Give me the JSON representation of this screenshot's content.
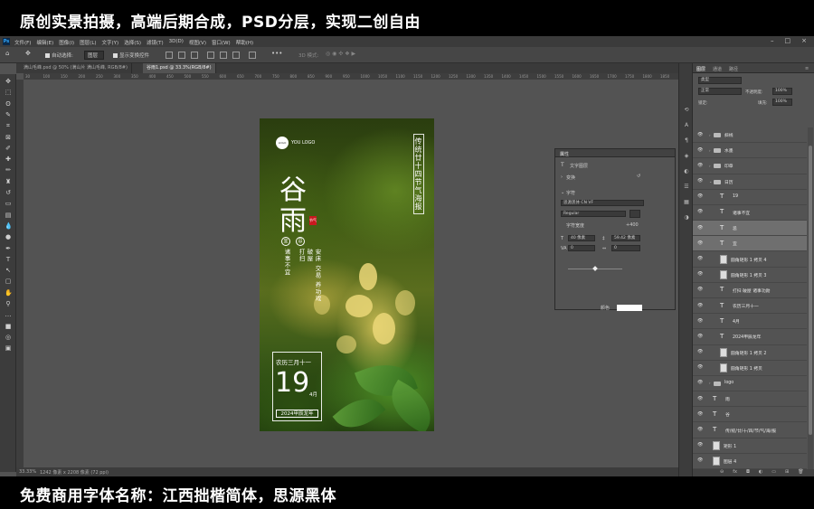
{
  "banner_top": "原创实景拍摄，高端后期合成，PSD分层，实现二创自由",
  "banner_bottom": "免费商用字体名称：江西拙楷简体，思源黑体",
  "menu": {
    "app_badge": "Ps",
    "items": [
      "文件(F)",
      "编辑(E)",
      "图像(I)",
      "图层(L)",
      "文字(Y)",
      "选择(S)",
      "滤镜(T)",
      "3D(D)",
      "视图(V)",
      "窗口(W)",
      "帮助(H)"
    ],
    "window_controls": [
      "–",
      "□",
      "×"
    ]
  },
  "options": {
    "auto_select_label": "自动选择:",
    "auto_select_value": "图层",
    "transform_label": "显示变换控件",
    "mode_3d": "3D 模式:"
  },
  "tabs": [
    {
      "label": "满山毛峰.psd @ 50% (满山片 满山毛峰, RGB/8#)",
      "active": false
    },
    {
      "label": "谷雨1.psd @ 33.3%(RGB/8#)",
      "active": true
    }
  ],
  "ruler": [
    "30",
    "100",
    "150",
    "200",
    "250",
    "300",
    "350",
    "400",
    "450",
    "500",
    "550",
    "600",
    "650",
    "700",
    "750",
    "800",
    "850",
    "900",
    "950",
    "1000",
    "1050",
    "1100",
    "1150",
    "1200",
    "1250",
    "1300",
    "1350",
    "1400",
    "1450",
    "1500",
    "1550",
    "1600",
    "1650",
    "1700",
    "1750",
    "1800",
    "1850"
  ],
  "status": {
    "zoom": "33.33%",
    "doc": "1242 像素 x 2208 像素 (72 ppi)"
  },
  "poster": {
    "logo_mark": "LOGO",
    "logo_text": "YOU LOGO",
    "vertical_title": "传统廿十四节气海报",
    "char1": "谷",
    "char2": "雨",
    "seal": "节气",
    "yi": "宜",
    "ji": "忌",
    "yi_text": "诸事不宜",
    "ji_text1": "打扫",
    "ji_text2": "破屋",
    "ji_text3": "安床 交易 养功戏",
    "lunar": "农历三月十一",
    "day": "19",
    "month": "4月",
    "year": "2024甲辰龙年"
  },
  "properties": {
    "title": "属性",
    "layer_type": "文字图层",
    "transform": "变换",
    "char_section": "字符",
    "font": "思源黑体 CN VF",
    "style": "Regular",
    "size": "40 像素",
    "leading": "59.42 像素",
    "tracking_label": "VA",
    "tracking": "0",
    "kerning": "0",
    "width_label": "字符宽度",
    "width_value": "+400",
    "color_label": "颜色",
    "more": "•••"
  },
  "layers_panel": {
    "tabs": [
      "图层",
      "通道",
      "路径"
    ],
    "kind": "类型",
    "blend": "正常",
    "opacity_label": "不透明度:",
    "opacity": "100%",
    "lock_label": "锁定:",
    "fill_label": "填充:",
    "fill": "100%",
    "rows": [
      {
        "name": "斜线",
        "kind": "folder",
        "indent": 0,
        "selected": false
      },
      {
        "name": "水墨",
        "kind": "folder",
        "indent": 0,
        "selected": false
      },
      {
        "name": "印章",
        "kind": "folder",
        "indent": 0,
        "selected": false
      },
      {
        "name": "日历",
        "kind": "folder-open",
        "indent": 0,
        "selected": false
      },
      {
        "name": "19",
        "kind": "text",
        "indent": 1,
        "selected": false
      },
      {
        "name": "诸事不宜",
        "kind": "text",
        "indent": 1,
        "selected": false
      },
      {
        "name": "忌",
        "kind": "text",
        "indent": 1,
        "selected": true
      },
      {
        "name": "宜",
        "kind": "text",
        "indent": 1,
        "selected": true
      },
      {
        "name": "圆角矩形 1 拷贝 4",
        "kind": "shape",
        "indent": 1,
        "selected": false
      },
      {
        "name": "圆角矩形 1 拷贝 3",
        "kind": "shape",
        "indent": 1,
        "selected": false
      },
      {
        "name": "打扫  破屋  诸事功勋",
        "kind": "text",
        "indent": 1,
        "selected": false
      },
      {
        "name": "农历三月十一",
        "kind": "text",
        "indent": 1,
        "selected": false
      },
      {
        "name": "4月",
        "kind": "text",
        "indent": 1,
        "selected": false
      },
      {
        "name": "2024甲辰龙年",
        "kind": "text",
        "indent": 1,
        "selected": false
      },
      {
        "name": "圆角矩形 1 拷贝 2",
        "kind": "shape",
        "indent": 1,
        "selected": false
      },
      {
        "name": "圆角矩形 1 拷贝",
        "kind": "shape",
        "indent": 1,
        "selected": false
      },
      {
        "name": "logo",
        "kind": "folder",
        "indent": 0,
        "selected": false
      },
      {
        "name": "雨",
        "kind": "text",
        "indent": 0,
        "selected": false
      },
      {
        "name": "谷",
        "kind": "text",
        "indent": 0,
        "selected": false
      },
      {
        "name": "传/统/廿/十/四/节/气/海/报",
        "kind": "text",
        "indent": 0,
        "selected": false
      },
      {
        "name": "矩形 1",
        "kind": "shape",
        "indent": 0,
        "selected": false
      },
      {
        "name": "图层 4",
        "kind": "shape",
        "indent": 0,
        "selected": false
      }
    ],
    "bottom_icons": [
      "link-icon",
      "fx-icon",
      "mask-icon",
      "adjustment-icon",
      "group-icon",
      "new-layer-icon",
      "trash-icon"
    ],
    "bottom_glyphs": [
      "⊖",
      "fx",
      "◘",
      "◐",
      "▭",
      "⊞",
      "🗑"
    ]
  }
}
